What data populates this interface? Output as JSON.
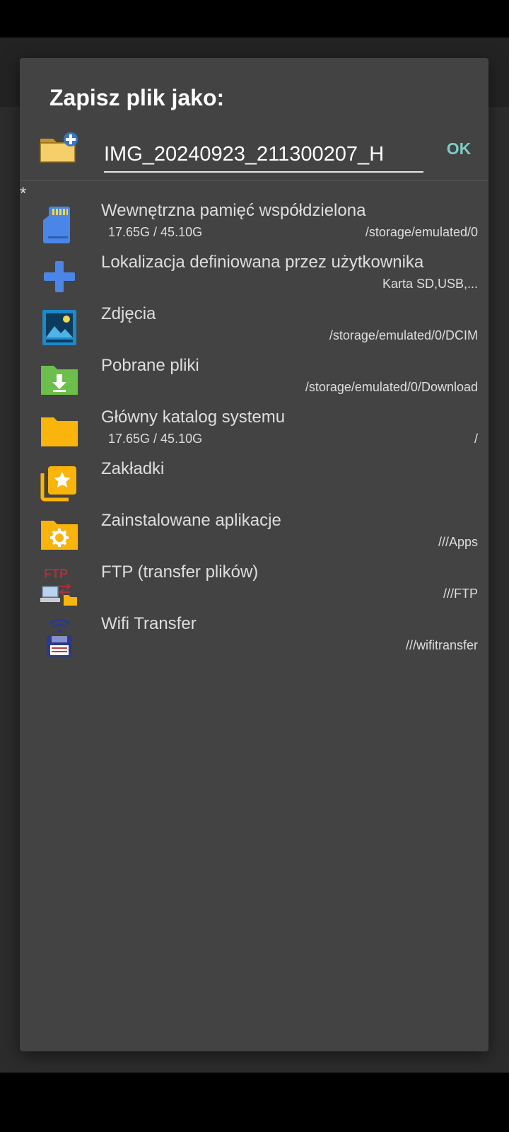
{
  "dialog": {
    "title": "Zapisz plik jako:",
    "filename": "IMG_20240923_211300207_H",
    "ok_label": "OK",
    "marker": "*"
  },
  "locations": [
    {
      "icon": "sd-card-icon",
      "title": "Wewnętrzna pamięć współdzielona",
      "size": "17.65G / 45.10G",
      "path": "/storage/emulated/0"
    },
    {
      "icon": "plus-icon",
      "title": "Lokalizacja definiowana przez użytkownika",
      "size": "",
      "path": "Karta SD,USB,..."
    },
    {
      "icon": "photo-icon",
      "title": "Zdjęcia",
      "size": "",
      "path": "/storage/emulated/0/DCIM"
    },
    {
      "icon": "download-folder-icon",
      "title": "Pobrane pliki",
      "size": "",
      "path": "/storage/emulated/0/Download"
    },
    {
      "icon": "folder-icon",
      "title": "Główny katalog systemu",
      "size": "17.65G / 45.10G",
      "path": "/"
    },
    {
      "icon": "bookmarks-icon",
      "title": "Zakładki",
      "size": "",
      "path": ""
    },
    {
      "icon": "apps-folder-icon",
      "title": "Zainstalowane aplikacje",
      "size": "",
      "path": "///Apps"
    },
    {
      "icon": "ftp-icon",
      "title": "FTP (transfer plików)",
      "size": "",
      "path": "///FTP"
    },
    {
      "icon": "wifi-transfer-icon",
      "title": "Wifi Transfer",
      "size": "",
      "path": "///wifitransfer"
    }
  ],
  "colors": {
    "dialog_bg": "#434343",
    "accent": "#80cbc4",
    "folder_yellow": "#fbb40b",
    "icon_blue": "#4a86e8",
    "download_green": "#6cbf4a"
  }
}
